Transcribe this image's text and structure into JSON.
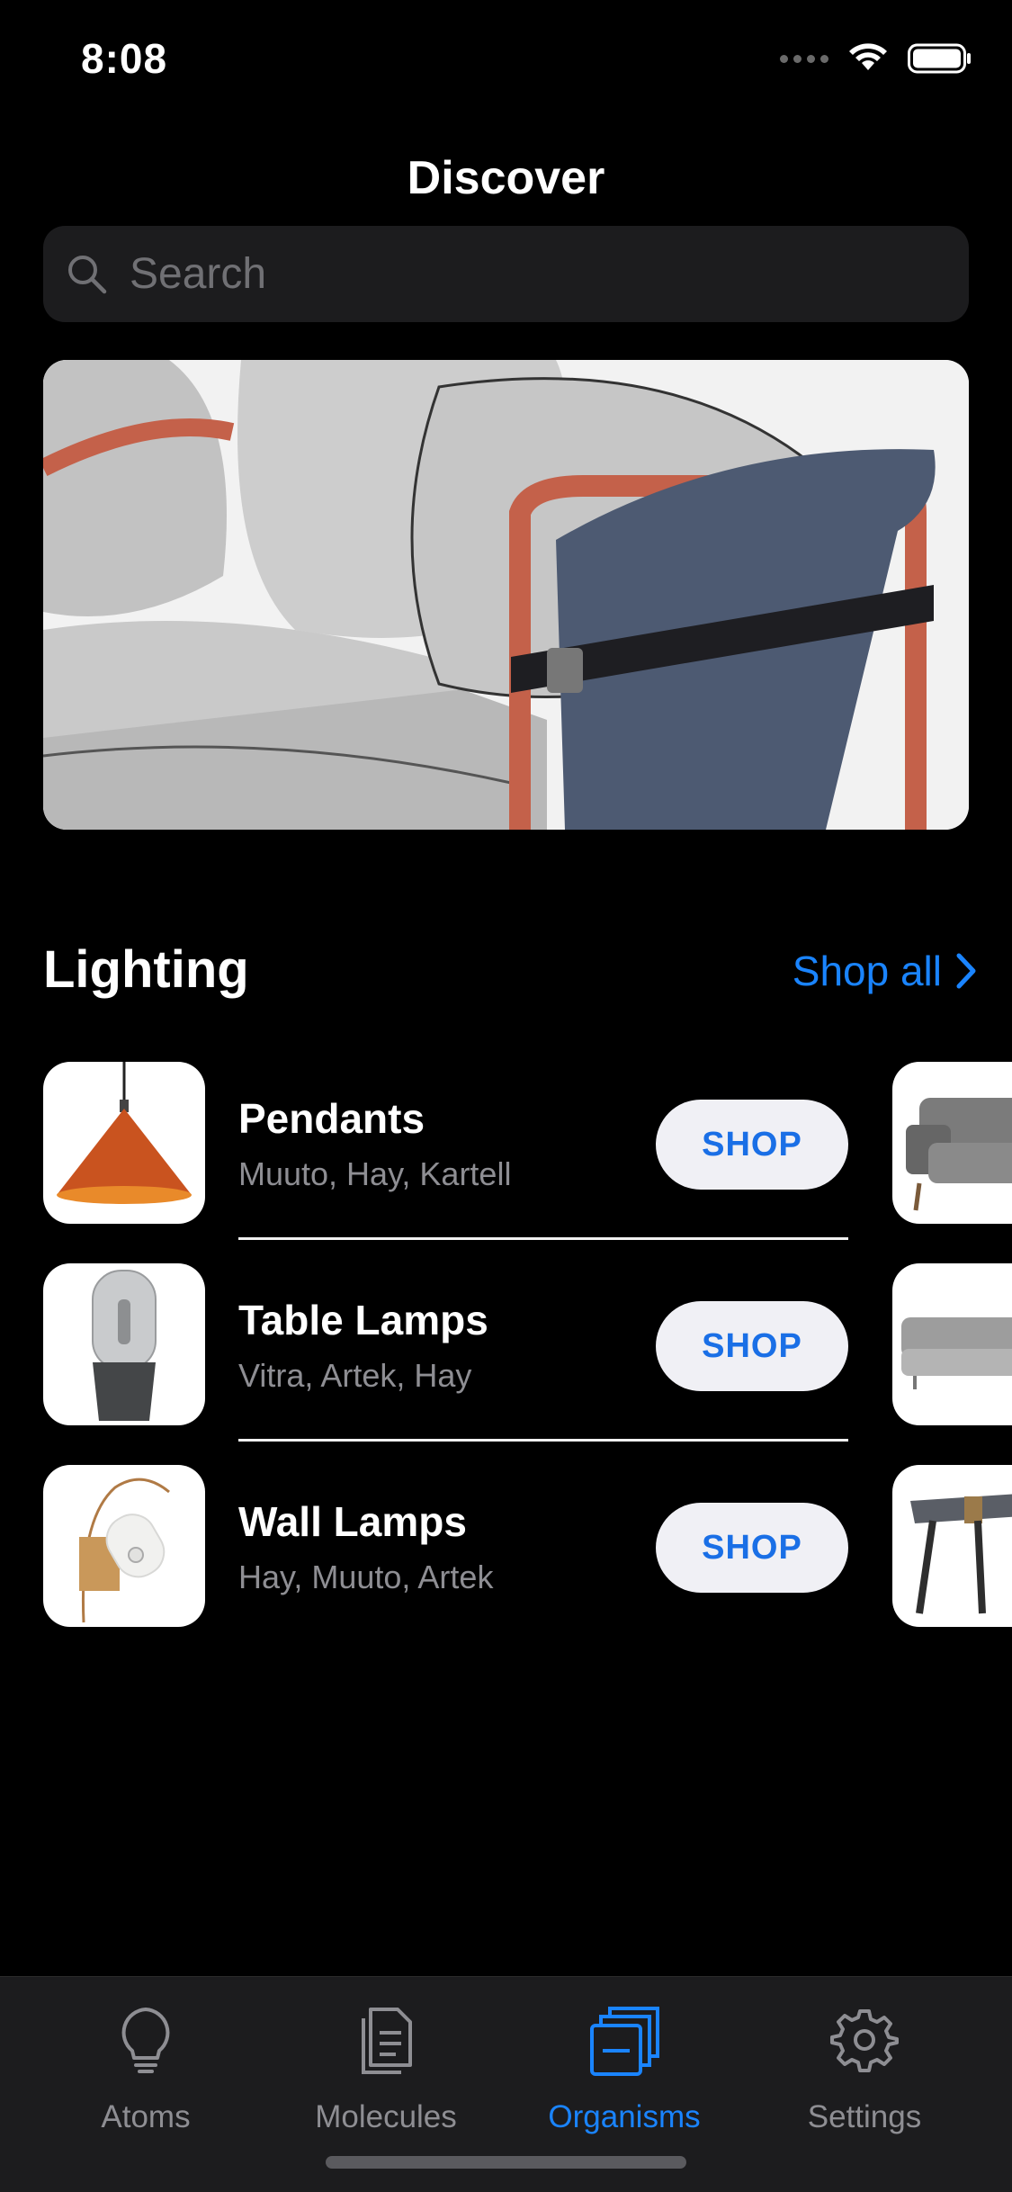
{
  "status_bar": {
    "time": "8:08"
  },
  "header": {
    "title": "Discover"
  },
  "search": {
    "placeholder": "Search"
  },
  "section": {
    "title": "Lighting",
    "shop_all_label": "Shop all"
  },
  "rows": [
    {
      "title": "Pendants",
      "brands": "Muuto, Hay, Kartell",
      "button": "SHOP"
    },
    {
      "title": "Table Lamps",
      "brands": "Vitra, Artek, Hay",
      "button": "SHOP"
    },
    {
      "title": "Wall Lamps",
      "brands": "Hay, Muuto, Artek",
      "button": "SHOP"
    }
  ],
  "tabbar": {
    "tabs": [
      {
        "label": "Atoms",
        "icon": "lightbulb-icon",
        "active": false
      },
      {
        "label": "Molecules",
        "icon": "document-icon",
        "active": false
      },
      {
        "label": "Organisms",
        "icon": "stack-icon",
        "active": true
      },
      {
        "label": "Settings",
        "icon": "gear-icon",
        "active": false
      }
    ]
  },
  "colors": {
    "accent": "#1a84ff",
    "background": "#000000",
    "surface": "#1c1c1e"
  }
}
